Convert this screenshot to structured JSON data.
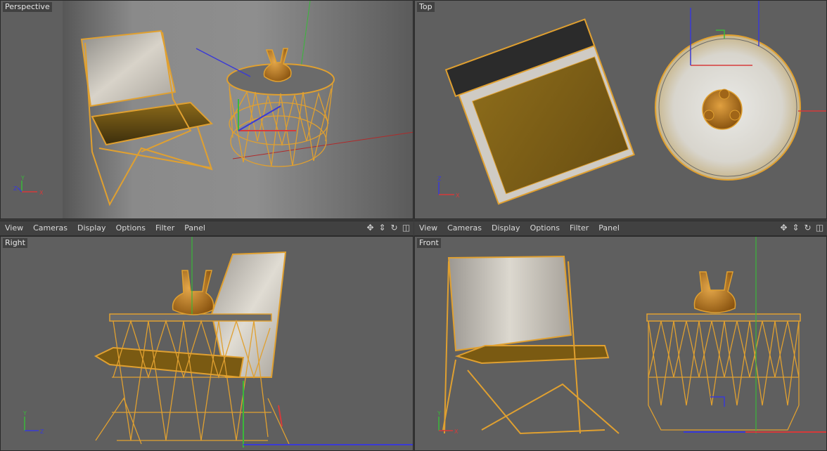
{
  "viewports": {
    "perspective": {
      "label": "Perspective"
    },
    "top": {
      "label": "Top"
    },
    "right": {
      "label": "Right"
    },
    "front": {
      "label": "Front"
    }
  },
  "menu": {
    "items": [
      "View",
      "Cameras",
      "Display",
      "Options",
      "Filter",
      "Panel"
    ]
  },
  "tools": [
    "move-icon",
    "pan-icon",
    "rotate-icon",
    "maximize-icon"
  ],
  "axes": {
    "x": "X",
    "y": "Y",
    "z": "Z"
  },
  "colors": {
    "viewport_bg": "#5f5f5f",
    "menubar_bg": "#414141",
    "selection": "#e0a030",
    "axis_x": "#d63a3a",
    "axis_y": "#3ab83a",
    "axis_z": "#3a3ad6",
    "cushion": "#7d5d14",
    "wood": "#cfcac0"
  }
}
